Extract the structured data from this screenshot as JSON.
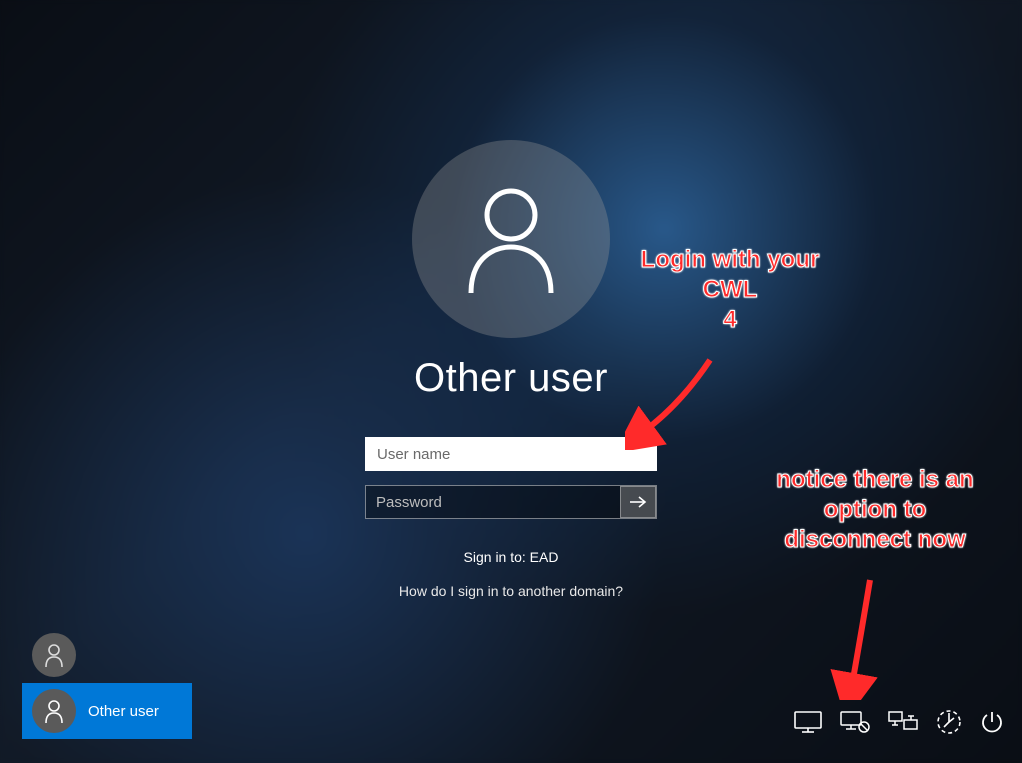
{
  "login": {
    "title": "Other user",
    "username_placeholder": "User name",
    "username_value": "",
    "password_placeholder": "Password",
    "password_value": "",
    "signin_to_label": "Sign in to: EAD",
    "domain_help_label": "How do I sign in to another domain?"
  },
  "user_list": {
    "items": [
      {
        "label": "",
        "selected": false
      },
      {
        "label": "Other user",
        "selected": true
      }
    ]
  },
  "tray": {
    "icons": [
      "display-icon",
      "network-icon",
      "disconnect-icon",
      "ease-of-access-icon",
      "power-icon"
    ]
  },
  "annotations": {
    "a1_lines": "Login with your\nCWL\n4",
    "a2_lines": "notice there is an\noption to\ndisconnect now"
  }
}
